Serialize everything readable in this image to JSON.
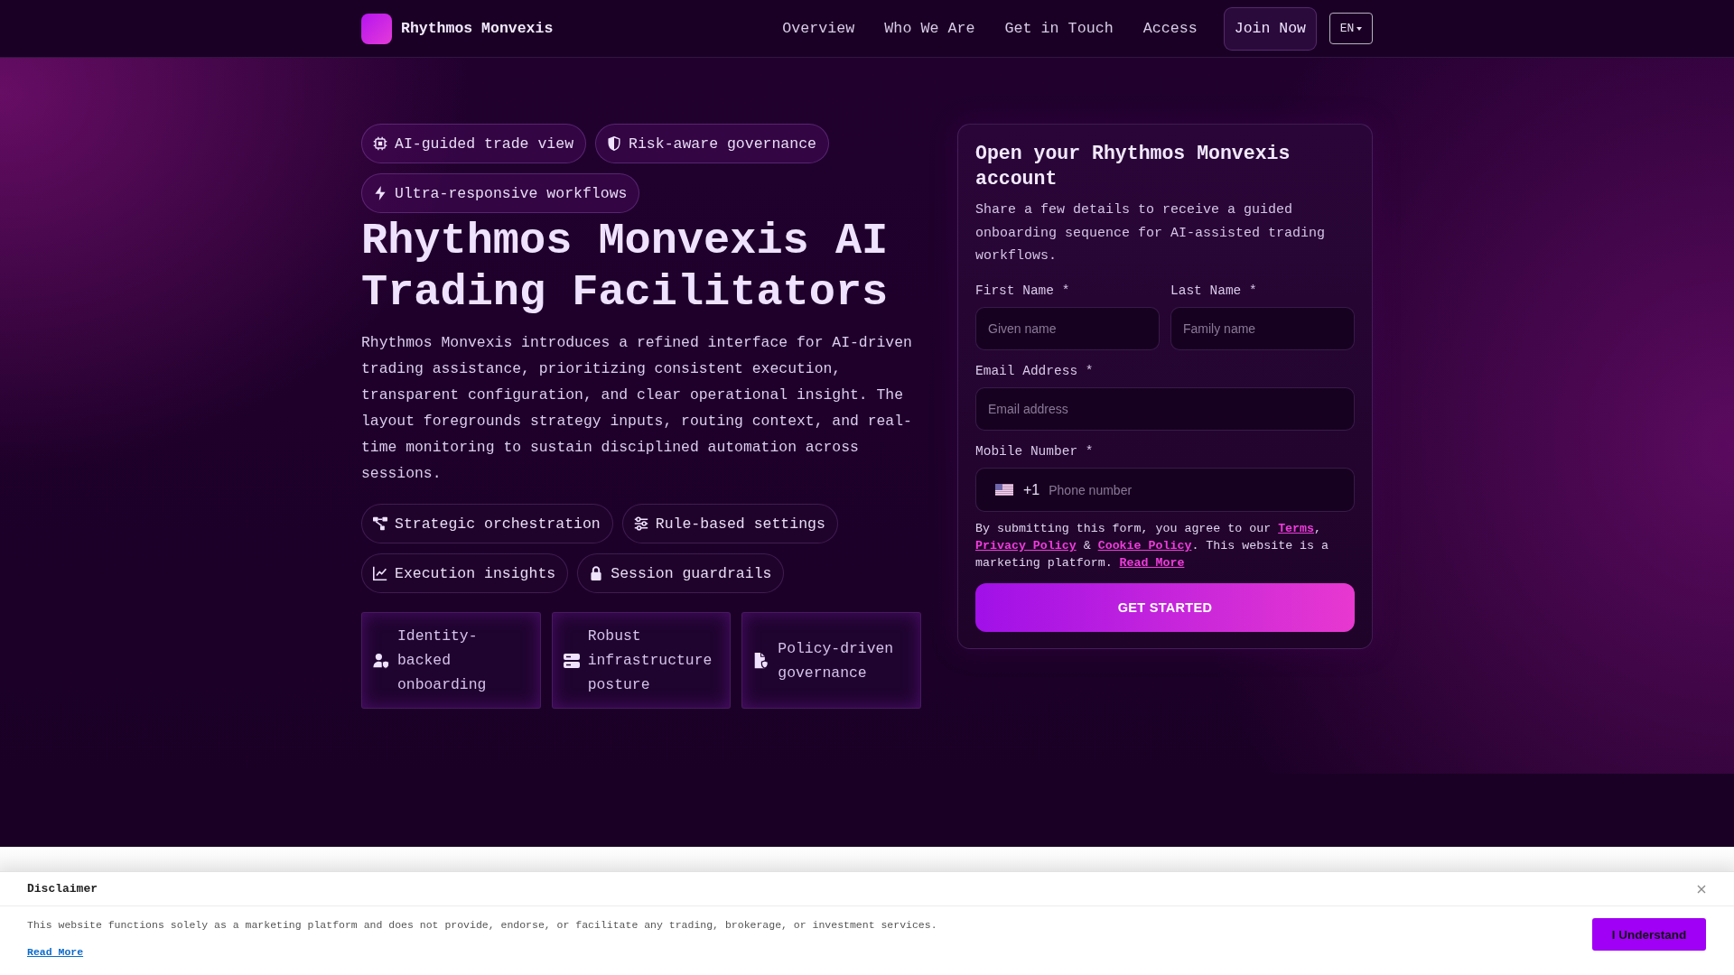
{
  "header": {
    "brand": "Rhythmos Monvexis",
    "nav": [
      "Overview",
      "Who We Are",
      "Get in Touch",
      "Access"
    ],
    "cta": "Join Now",
    "language": "EN"
  },
  "hero": {
    "badges": [
      "AI-guided trade view",
      "Risk-aware governance",
      "Ultra-responsive workflows"
    ],
    "title": "Rhythmos Monvexis AI Trading Facilitators",
    "description": "Rhythmos Monvexis introduces a refined interface for AI-driven trading assistance, prioritizing consistent execution, transparent configuration, and clear operational insight. The layout foregrounds strategy inputs, routing context, and real-time monitoring to sustain disciplined automation across sessions.",
    "features": [
      "Strategic orchestration",
      "Rule-based settings",
      "Execution insights",
      "Session guardrails"
    ],
    "cards": [
      "Identity-backed onboarding",
      "Robust infrastructure posture",
      "Policy-driven governance"
    ]
  },
  "signup_form": {
    "title": "Open your Rhythmos Monvexis account",
    "description": "Share a few details to receive a guided onboarding sequence for AI-assisted trading workflows.",
    "fields": [
      {
        "kind": "text",
        "label": "First Name *",
        "placeholder": "Given name"
      },
      {
        "kind": "text",
        "label": "Last Name *",
        "placeholder": "Family name"
      },
      {
        "kind": "email",
        "label": "Email Address *",
        "placeholder": "Email address"
      },
      {
        "kind": "phone",
        "label": "Mobile Number *",
        "dial_code": "+1",
        "placeholder": "Phone number"
      }
    ],
    "consent": [
      {
        "kind": "text",
        "text": "By submitting this form, you agree to our "
      },
      {
        "kind": "link",
        "text": "Terms"
      },
      {
        "kind": "text",
        "text": ", "
      },
      {
        "kind": "link",
        "text": "Privacy Policy"
      },
      {
        "kind": "text",
        "text": " & "
      },
      {
        "kind": "link",
        "text": "Cookie Policy"
      },
      {
        "kind": "text",
        "text": ". This website is a marketing platform. "
      },
      {
        "kind": "link",
        "text": "Read More"
      }
    ],
    "submit": "GET STARTED"
  },
  "disclaimer": {
    "title": "Disclaimer",
    "text": "This website functions solely as a marketing platform and does not provide, endorse, or facilitate any trading, brokerage, or investment services.",
    "link": "Read More",
    "button": "I Understand"
  }
}
